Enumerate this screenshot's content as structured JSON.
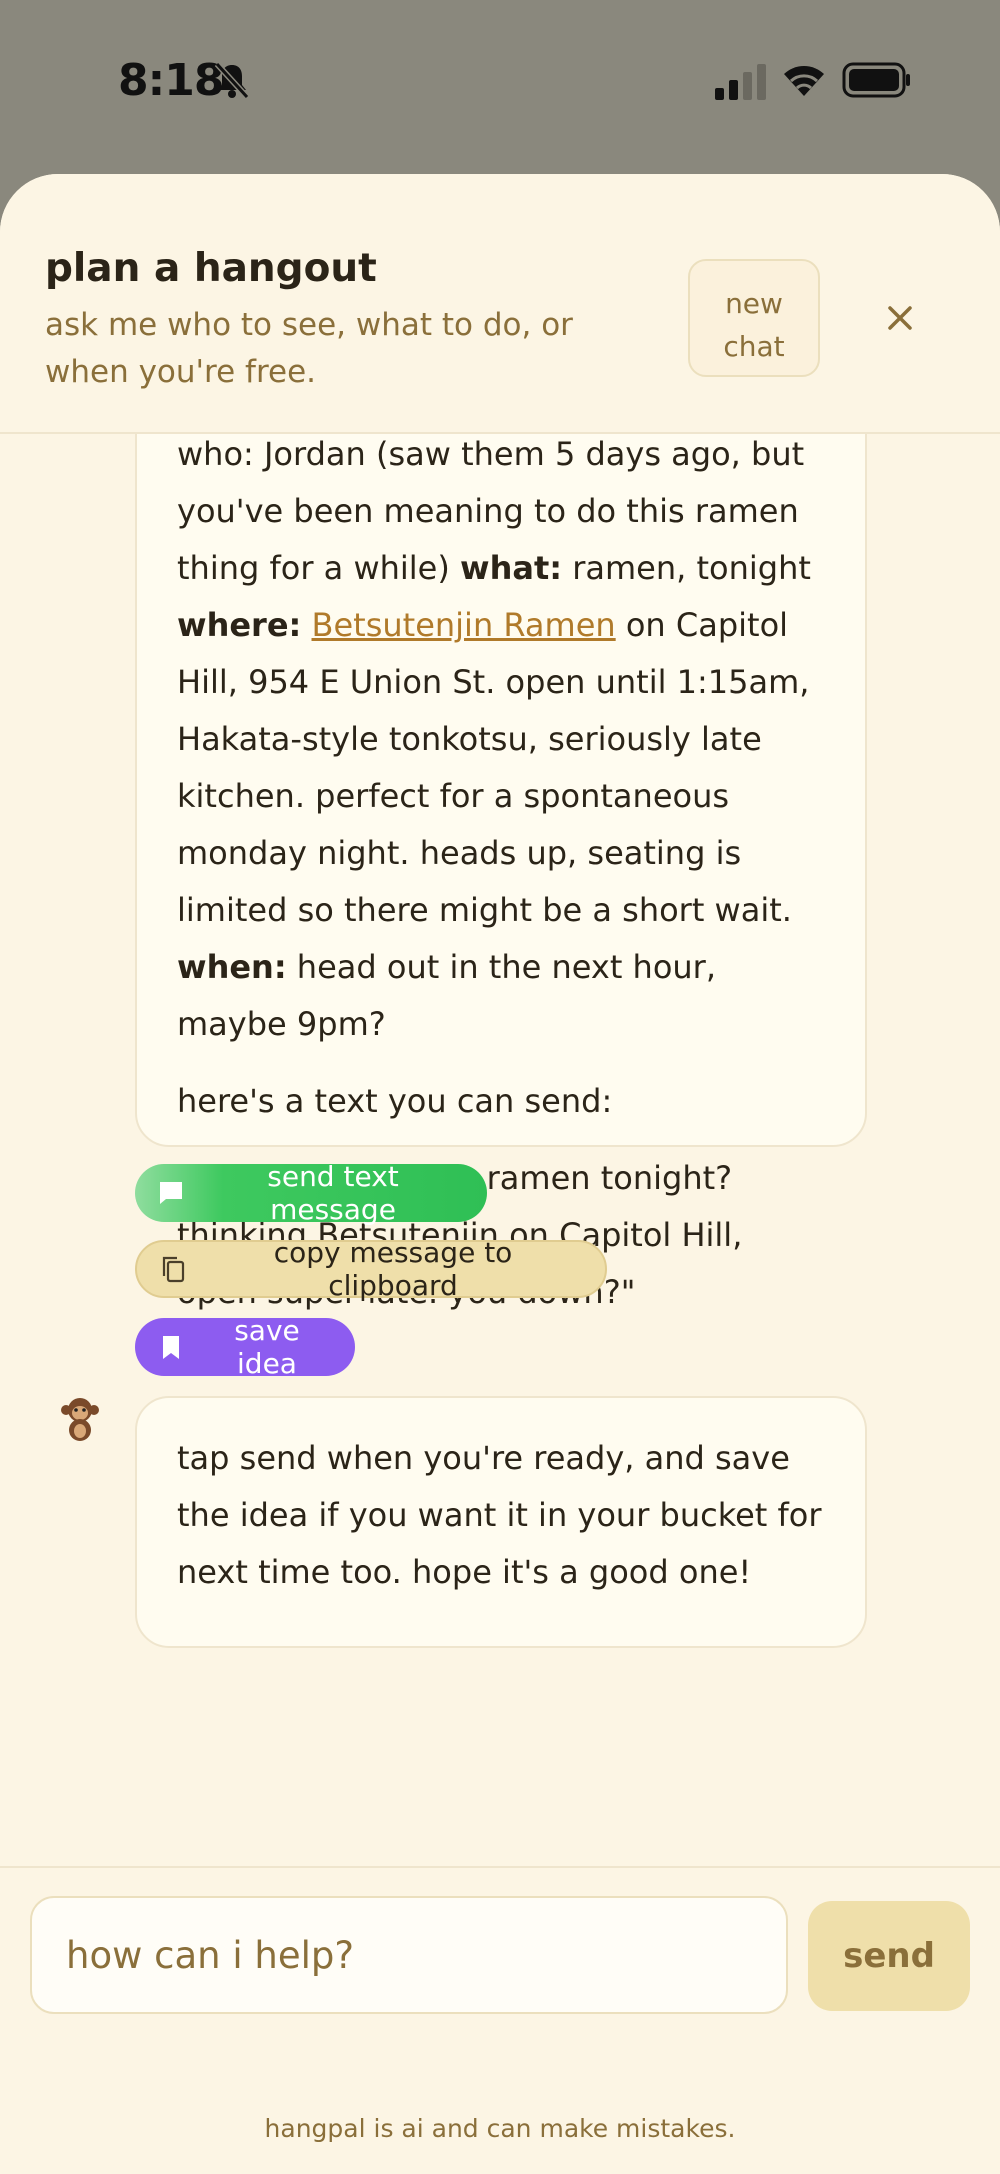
{
  "status_bar": {
    "time": "8:18"
  },
  "header": {
    "title": "plan a hangout",
    "subtitle": "ask me who to see, what to do, or when you're free.",
    "new_chat_label": "new\nchat"
  },
  "messages": {
    "plan": {
      "who_partial": "who: Jordan (saw them 5 days ago, but",
      "who_rest": "you've been meaning to do this ramen thing for a while)",
      "what_label": "what:",
      "what_value": "ramen, tonight",
      "where_label": "where:",
      "where_link": "Betsutenjin Ramen",
      "where_value": "on Capitol Hill, 954 E Union St. open until 1:15am, Hakata-style tonkotsu, seriously late kitchen. perfect for a spontaneous monday night. heads up, seating is limited so there might be a short wait.",
      "when_label": "when:",
      "when_value": "head out in the next hour, maybe 9pm?",
      "intro": "here's a text you can send:",
      "draft_text": "\"hey, spontaneous ramen tonight? thinking Betsutenjin on Capitol Hill, open super late. you down?\""
    },
    "actions": {
      "send_text": "send text message",
      "copy": "copy message to clipboard",
      "save": "save idea"
    },
    "followup": "tap send when you're ready, and save the idea if you want it in your bucket for next time too. hope it's a good one!"
  },
  "composer": {
    "placeholder": "how can i help?",
    "send_label": "send"
  },
  "disclaimer": "hangpal is ai and can make mistakes.",
  "colors": {
    "sheet_bg": "#fcf5e4",
    "accent_brown": "#8a6f3a",
    "link": "#b07a2a",
    "send_green": "#2fbf55",
    "save_purple": "#8d5cf0",
    "chip_tan": "#efdfaa"
  },
  "icons": {
    "bell": "bell-slash-icon",
    "signal": "cellular-signal-icon",
    "wifi": "wifi-icon",
    "battery": "battery-icon",
    "close": "close-icon",
    "message": "message-bubble-icon",
    "copy": "copy-icon",
    "bookmark": "bookmark-icon",
    "avatar": "monkey-avatar-icon"
  }
}
